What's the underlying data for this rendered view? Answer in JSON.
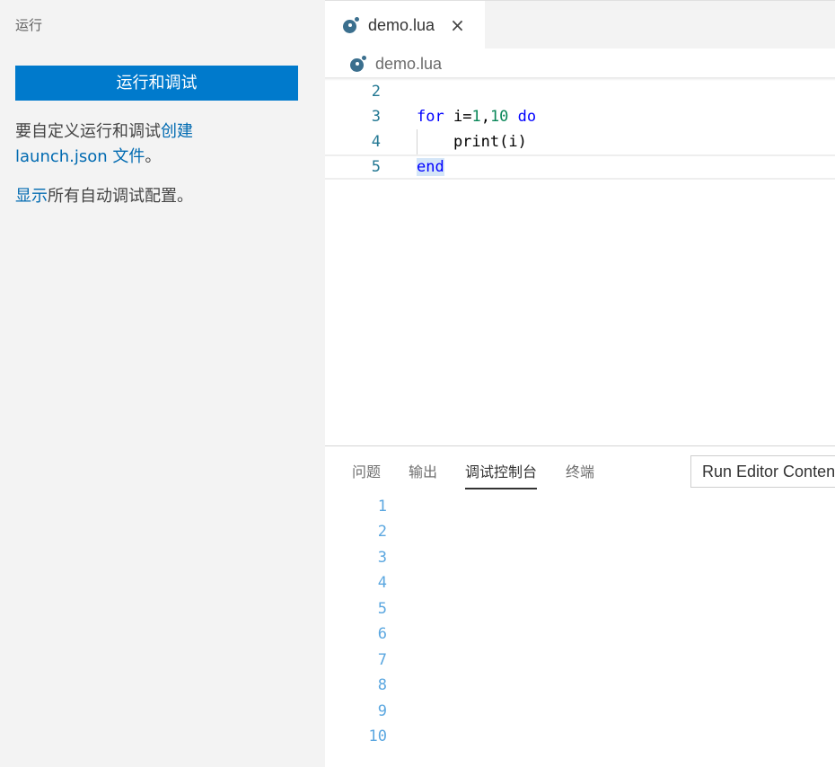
{
  "sidebar": {
    "title": "运行",
    "run_button": "运行和调试",
    "help_prefix": "要自定义运行和调试",
    "help_link_create": "创建",
    "help_link_file": "launch.json 文件",
    "help_suffix": "。",
    "show_all_link": "显示",
    "show_all_text": "所有自动调试配置。"
  },
  "editor": {
    "tab_label": "demo.lua",
    "tab_close": "×",
    "breadcrumb": "demo.lua",
    "lines": [
      {
        "num": "2"
      },
      {
        "num": "3",
        "kw1": "for",
        "t1": " i=",
        "n1": "1",
        "t2": ",",
        "n2": "10",
        "t3": " ",
        "kw2": "do"
      },
      {
        "num": "4",
        "text": "    print(i)"
      },
      {
        "num": "5",
        "kw": "end"
      }
    ]
  },
  "panel": {
    "tabs": [
      "问题",
      "输出",
      "调试控制台",
      "终端"
    ],
    "active_tab": "调试控制台",
    "select_value": "Run Editor Contents",
    "console_line_numbers": [
      "1",
      "2",
      "3",
      "4",
      "5",
      "6",
      "7",
      "8",
      "9",
      "10"
    ]
  },
  "colors": {
    "accent": "#007acc",
    "link": "#006ab1",
    "keyword": "#0000ff",
    "number": "#098658",
    "line_number": "#237893",
    "console_number": "#5ba7e0"
  },
  "icons": {
    "tab_icon": "lua-icon",
    "breadcrumb_icon": "lua-icon",
    "close": "close-icon"
  }
}
